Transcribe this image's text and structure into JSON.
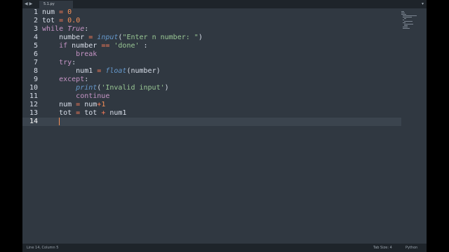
{
  "tabbar": {
    "nav_left": "◀",
    "nav_right": "▶",
    "tab_title": "5.1.py",
    "dropdown": "▾"
  },
  "gutter": {
    "line_numbers": [
      "1",
      "2",
      "3",
      "4",
      "5",
      "6",
      "7",
      "8",
      "9",
      "10",
      "11",
      "12",
      "13",
      "14"
    ],
    "current_line": "14"
  },
  "code": {
    "lines": [
      [
        {
          "t": "num ",
          "c": ""
        },
        {
          "t": "=",
          "c": "op"
        },
        {
          "t": " ",
          "c": ""
        },
        {
          "t": "0",
          "c": "num"
        }
      ],
      [
        {
          "t": "tot ",
          "c": ""
        },
        {
          "t": "=",
          "c": "op"
        },
        {
          "t": " ",
          "c": ""
        },
        {
          "t": "0.0",
          "c": "num"
        }
      ],
      [
        {
          "t": "while",
          "c": "kw"
        },
        {
          "t": " ",
          "c": ""
        },
        {
          "t": "True",
          "c": "kw-i"
        },
        {
          "t": ":",
          "c": ""
        }
      ],
      [
        {
          "t": "    number ",
          "c": ""
        },
        {
          "t": "=",
          "c": "op"
        },
        {
          "t": " ",
          "c": ""
        },
        {
          "t": "input",
          "c": "fn"
        },
        {
          "t": "(",
          "c": ""
        },
        {
          "t": "\"Enter n number: \"",
          "c": "str"
        },
        {
          "t": ")",
          "c": ""
        }
      ],
      [
        {
          "t": "    ",
          "c": ""
        },
        {
          "t": "if",
          "c": "kw"
        },
        {
          "t": " number ",
          "c": ""
        },
        {
          "t": "==",
          "c": "op"
        },
        {
          "t": " ",
          "c": ""
        },
        {
          "t": "'done'",
          "c": "str"
        },
        {
          "t": " :",
          "c": ""
        }
      ],
      [
        {
          "t": "        ",
          "c": ""
        },
        {
          "t": "break",
          "c": "kw"
        }
      ],
      [
        {
          "t": "    ",
          "c": ""
        },
        {
          "t": "try",
          "c": "kw"
        },
        {
          "t": ":",
          "c": ""
        }
      ],
      [
        {
          "t": "        num1 ",
          "c": ""
        },
        {
          "t": "=",
          "c": "op"
        },
        {
          "t": " ",
          "c": ""
        },
        {
          "t": "float",
          "c": "fn"
        },
        {
          "t": "(number)",
          "c": ""
        }
      ],
      [
        {
          "t": "    ",
          "c": ""
        },
        {
          "t": "except",
          "c": "kw"
        },
        {
          "t": ":",
          "c": ""
        }
      ],
      [
        {
          "t": "        ",
          "c": ""
        },
        {
          "t": "print",
          "c": "fn"
        },
        {
          "t": "(",
          "c": ""
        },
        {
          "t": "'Invalid input'",
          "c": "str"
        },
        {
          "t": ")",
          "c": ""
        }
      ],
      [
        {
          "t": "        ",
          "c": ""
        },
        {
          "t": "continue",
          "c": "kw"
        }
      ],
      [
        {
          "t": "    num ",
          "c": ""
        },
        {
          "t": "=",
          "c": "op"
        },
        {
          "t": " num",
          "c": ""
        },
        {
          "t": "+",
          "c": "op"
        },
        {
          "t": "1",
          "c": "num"
        }
      ],
      [
        {
          "t": "    tot ",
          "c": ""
        },
        {
          "t": "=",
          "c": "op"
        },
        {
          "t": " tot ",
          "c": ""
        },
        {
          "t": "+",
          "c": "op"
        },
        {
          "t": " num1",
          "c": ""
        }
      ],
      [
        {
          "t": "    ",
          "c": ""
        }
      ]
    ]
  },
  "statusbar": {
    "position": "Line 14, Column 5",
    "tab_size": "Tab Size: 4",
    "syntax": "Python"
  },
  "colors": {
    "background": "#303841",
    "keyword": "#c594c5",
    "number": "#f99157",
    "operator": "#f97b58",
    "string": "#99c794",
    "function": "#6699cc",
    "cursor": "#f99157"
  }
}
